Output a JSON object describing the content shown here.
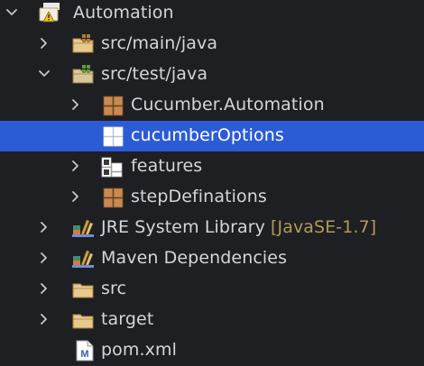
{
  "project": {
    "label": "Automation",
    "icon": "maven-project-warning-icon",
    "expanded": true
  },
  "items": [
    {
      "key": "src_main_java",
      "label": "src/main/java",
      "icon": "source-folder-icon",
      "expanded": false
    },
    {
      "key": "src_test_java",
      "label": "src/test/java",
      "icon": "test-source-folder-icon",
      "expanded": true
    },
    {
      "key": "pkg_cucumber_automation",
      "label": "Cucumber.Automation",
      "icon": "package-icon",
      "expanded": false
    },
    {
      "key": "pkg_cucumber_options",
      "label": "cucumberOptions",
      "icon": "empty-package-icon",
      "selected": true
    },
    {
      "key": "pkg_features",
      "label": "features",
      "icon": "package-folder-icon",
      "expanded": false
    },
    {
      "key": "pkg_step_definations",
      "label": "stepDefinations",
      "icon": "package-icon",
      "expanded": false
    },
    {
      "key": "jre_library",
      "label": "JRE System Library",
      "decoration": "[JavaSE-1.7]",
      "icon": "library-icon",
      "expanded": false
    },
    {
      "key": "maven_deps",
      "label": "Maven Dependencies",
      "icon": "library-icon",
      "expanded": false
    },
    {
      "key": "folder_src",
      "label": "src",
      "icon": "folder-icon",
      "expanded": false
    },
    {
      "key": "folder_target",
      "label": "target",
      "icon": "folder-icon",
      "expanded": false
    },
    {
      "key": "pom_xml",
      "label": "pom.xml",
      "icon": "maven-file-icon"
    }
  ],
  "colors": {
    "background": "#1e1f22",
    "selection": "#2c5bd6",
    "text": "#d6d6d6",
    "decoration": "#b39a5a"
  }
}
